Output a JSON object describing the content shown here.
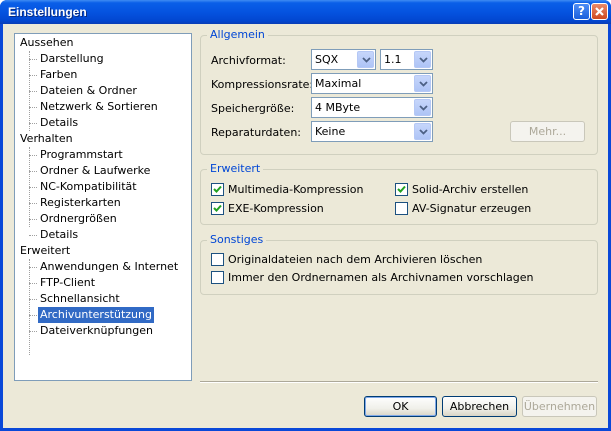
{
  "window": {
    "title": "Einstellungen",
    "help_label": "?",
    "close_label": "x"
  },
  "tree": {
    "items": [
      {
        "label": "Aussehen"
      },
      {
        "label": "Darstellung"
      },
      {
        "label": "Farben"
      },
      {
        "label": "Dateien & Ordner"
      },
      {
        "label": "Netzwerk & Sortieren"
      },
      {
        "label": "Details"
      },
      {
        "label": "Verhalten"
      },
      {
        "label": "Programmstart"
      },
      {
        "label": "Ordner & Laufwerke"
      },
      {
        "label": "NC-Kompatibilität"
      },
      {
        "label": "Registerkarten"
      },
      {
        "label": "Ordnergrößen"
      },
      {
        "label": "Details"
      },
      {
        "label": "Erweitert"
      },
      {
        "label": "Anwendungen & Internet"
      },
      {
        "label": "FTP-Client"
      },
      {
        "label": "Schnellansicht"
      },
      {
        "label": "Archivunterstützung",
        "selected": true
      },
      {
        "label": "Dateiverknüpfungen"
      }
    ]
  },
  "allgemein": {
    "title": "Allgemein",
    "archivformat_label": "Archivformat:",
    "archivformat_value": "SQX",
    "version_value": "1.1",
    "kompression_label": "Kompressionsrate:",
    "kompression_value": "Maximal",
    "speicher_label": "Speichergröße:",
    "speicher_value": "4 MByte",
    "reparatur_label": "Reparaturdaten:",
    "reparatur_value": "Keine",
    "mehr_label": "Mehr..."
  },
  "erweitert": {
    "title": "Erweitert",
    "multimedia_label": "Multimedia-Kompression",
    "multimedia_checked": true,
    "exe_label": "EXE-Kompression",
    "exe_checked": true,
    "solid_label": "Solid-Archiv erstellen",
    "solid_checked": true,
    "av_label": "AV-Signatur erzeugen",
    "av_checked": false
  },
  "sonstiges": {
    "title": "Sonstiges",
    "loeschen_label": "Originaldateien nach dem Archivieren löschen",
    "loeschen_checked": false,
    "ordnername_label": "Immer den Ordnernamen als Archivnamen vorschlagen",
    "ordnername_checked": false
  },
  "buttons": {
    "ok": "OK",
    "abbrechen": "Abbrechen",
    "uebernehmen": "Übernehmen"
  },
  "colors": {
    "accent": "#0046d5",
    "selection": "#316ac5",
    "titlebar": "#0553e0"
  }
}
